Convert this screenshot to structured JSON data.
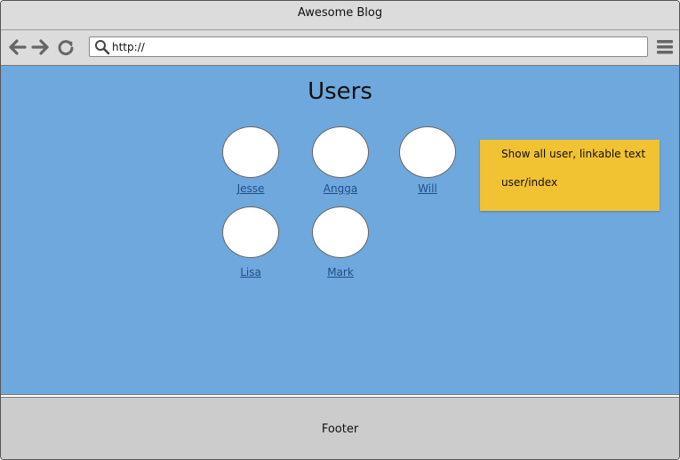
{
  "window": {
    "title": "Awesome Blog"
  },
  "toolbar": {
    "back_icon": "arrow-left-icon",
    "forward_icon": "arrow-right-icon",
    "reload_icon": "reload-icon",
    "search_icon": "search-icon",
    "menu_icon": "hamburger-menu-icon",
    "url": "http://"
  },
  "page": {
    "title": "Users",
    "background_color": "#6fa8dc",
    "users": [
      {
        "name": "Jesse"
      },
      {
        "name": "Angga"
      },
      {
        "name": "Will"
      },
      {
        "name": "Lisa"
      },
      {
        "name": "Mark"
      }
    ]
  },
  "note": {
    "line1": "Show all user, linkable text",
    "line2": "user/index",
    "color": "#f1c232"
  },
  "footer": {
    "label": "Footer"
  }
}
